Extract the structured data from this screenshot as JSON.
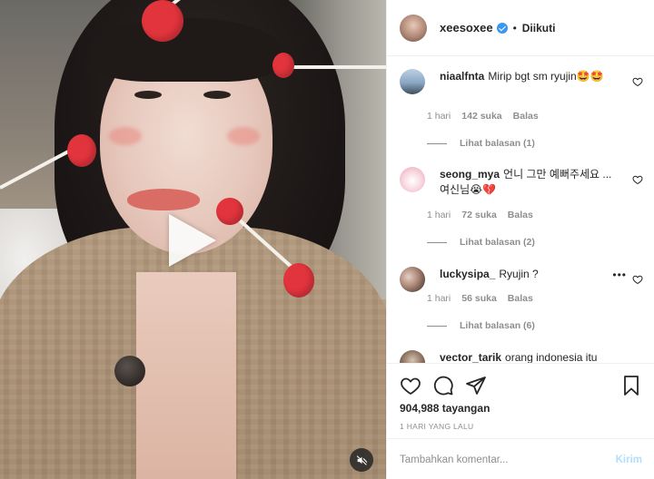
{
  "media": {
    "type": "video",
    "muted": true,
    "icons": {
      "play": "play-icon",
      "mute": "speaker-muted-icon"
    }
  },
  "header": {
    "username": "xeesoxee",
    "verified": true,
    "separator": "•",
    "follow_state": "Diikuti"
  },
  "comments": [
    {
      "username": "niaalfnta",
      "text": "Mirip bgt sm ryujin🤩🤩",
      "time": "1 hari",
      "likes": "142 suka",
      "reply": "Balas",
      "view_replies": "Lihat balasan (1)"
    },
    {
      "username": "seong_mya",
      "text": "언니 그만 예뻐주세요 ... 여신님😭💔",
      "time": "1 hari",
      "likes": "72 suka",
      "reply": "Balas",
      "view_replies": "Lihat balasan (2)"
    },
    {
      "username": "luckysipa_",
      "text": "Ryujin ?",
      "time": "1 hari",
      "likes": "56 suka",
      "reply": "Balas",
      "view_replies": "Lihat balasan (6)"
    },
    {
      "username": "vector_tarik",
      "text": "orang indonesia itu",
      "partial": true
    }
  ],
  "actions": {
    "icons": [
      "heart-icon",
      "comment-icon",
      "share-icon",
      "bookmark-icon"
    ],
    "views": "904,988 tayangan",
    "date": "1 HARI YANG LALU"
  },
  "composer": {
    "placeholder": "Tambahkan komentar...",
    "post_label": "Kirim"
  },
  "colors": {
    "accent": "#3897f0",
    "post_disabled": "#b2dffc",
    "muted_text": "#8e8e8e",
    "pin_red": "#e2343d"
  }
}
